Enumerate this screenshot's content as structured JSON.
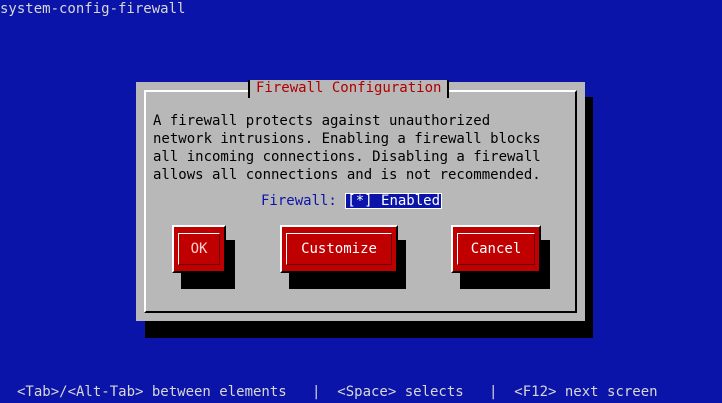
{
  "app": {
    "title": "system-config-firewall"
  },
  "dialog": {
    "title": "Firewall Configuration",
    "description": "A firewall protects against unauthorized\nnetwork intrusions. Enabling a firewall blocks\nall incoming connections. Disabling a firewall\nallows all connections and is not recommended.",
    "firewall_label": "Firewall:",
    "firewall_checkbox": "[*] Enabled",
    "firewall_enabled": true
  },
  "buttons": {
    "ok": "OK",
    "customize": "Customize",
    "cancel": "Cancel"
  },
  "status_bar": {
    "text": "<Tab>/<Alt-Tab> between elements   |  <Space> selects   |  <F12> next screen"
  },
  "colors": {
    "background": "#0a14a8",
    "dialog": "#b8b8b8",
    "button": "#c00000",
    "title_text": "#b00000"
  }
}
